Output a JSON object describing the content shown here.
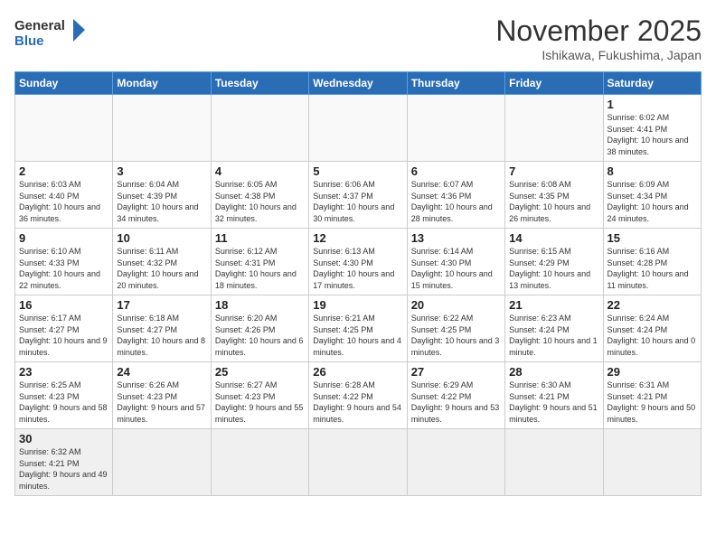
{
  "logo": {
    "line1": "General",
    "line2": "Blue"
  },
  "title": "November 2025",
  "location": "Ishikawa, Fukushima, Japan",
  "days_of_week": [
    "Sunday",
    "Monday",
    "Tuesday",
    "Wednesday",
    "Thursday",
    "Friday",
    "Saturday"
  ],
  "weeks": [
    [
      {
        "day": "",
        "info": ""
      },
      {
        "day": "",
        "info": ""
      },
      {
        "day": "",
        "info": ""
      },
      {
        "day": "",
        "info": ""
      },
      {
        "day": "",
        "info": ""
      },
      {
        "day": "",
        "info": ""
      },
      {
        "day": "1",
        "info": "Sunrise: 6:02 AM\nSunset: 4:41 PM\nDaylight: 10 hours and 38 minutes."
      }
    ],
    [
      {
        "day": "2",
        "info": "Sunrise: 6:03 AM\nSunset: 4:40 PM\nDaylight: 10 hours and 36 minutes."
      },
      {
        "day": "3",
        "info": "Sunrise: 6:04 AM\nSunset: 4:39 PM\nDaylight: 10 hours and 34 minutes."
      },
      {
        "day": "4",
        "info": "Sunrise: 6:05 AM\nSunset: 4:38 PM\nDaylight: 10 hours and 32 minutes."
      },
      {
        "day": "5",
        "info": "Sunrise: 6:06 AM\nSunset: 4:37 PM\nDaylight: 10 hours and 30 minutes."
      },
      {
        "day": "6",
        "info": "Sunrise: 6:07 AM\nSunset: 4:36 PM\nDaylight: 10 hours and 28 minutes."
      },
      {
        "day": "7",
        "info": "Sunrise: 6:08 AM\nSunset: 4:35 PM\nDaylight: 10 hours and 26 minutes."
      },
      {
        "day": "8",
        "info": "Sunrise: 6:09 AM\nSunset: 4:34 PM\nDaylight: 10 hours and 24 minutes."
      }
    ],
    [
      {
        "day": "9",
        "info": "Sunrise: 6:10 AM\nSunset: 4:33 PM\nDaylight: 10 hours and 22 minutes."
      },
      {
        "day": "10",
        "info": "Sunrise: 6:11 AM\nSunset: 4:32 PM\nDaylight: 10 hours and 20 minutes."
      },
      {
        "day": "11",
        "info": "Sunrise: 6:12 AM\nSunset: 4:31 PM\nDaylight: 10 hours and 18 minutes."
      },
      {
        "day": "12",
        "info": "Sunrise: 6:13 AM\nSunset: 4:30 PM\nDaylight: 10 hours and 17 minutes."
      },
      {
        "day": "13",
        "info": "Sunrise: 6:14 AM\nSunset: 4:30 PM\nDaylight: 10 hours and 15 minutes."
      },
      {
        "day": "14",
        "info": "Sunrise: 6:15 AM\nSunset: 4:29 PM\nDaylight: 10 hours and 13 minutes."
      },
      {
        "day": "15",
        "info": "Sunrise: 6:16 AM\nSunset: 4:28 PM\nDaylight: 10 hours and 11 minutes."
      }
    ],
    [
      {
        "day": "16",
        "info": "Sunrise: 6:17 AM\nSunset: 4:27 PM\nDaylight: 10 hours and 9 minutes."
      },
      {
        "day": "17",
        "info": "Sunrise: 6:18 AM\nSunset: 4:27 PM\nDaylight: 10 hours and 8 minutes."
      },
      {
        "day": "18",
        "info": "Sunrise: 6:20 AM\nSunset: 4:26 PM\nDaylight: 10 hours and 6 minutes."
      },
      {
        "day": "19",
        "info": "Sunrise: 6:21 AM\nSunset: 4:25 PM\nDaylight: 10 hours and 4 minutes."
      },
      {
        "day": "20",
        "info": "Sunrise: 6:22 AM\nSunset: 4:25 PM\nDaylight: 10 hours and 3 minutes."
      },
      {
        "day": "21",
        "info": "Sunrise: 6:23 AM\nSunset: 4:24 PM\nDaylight: 10 hours and 1 minute."
      },
      {
        "day": "22",
        "info": "Sunrise: 6:24 AM\nSunset: 4:24 PM\nDaylight: 10 hours and 0 minutes."
      }
    ],
    [
      {
        "day": "23",
        "info": "Sunrise: 6:25 AM\nSunset: 4:23 PM\nDaylight: 9 hours and 58 minutes."
      },
      {
        "day": "24",
        "info": "Sunrise: 6:26 AM\nSunset: 4:23 PM\nDaylight: 9 hours and 57 minutes."
      },
      {
        "day": "25",
        "info": "Sunrise: 6:27 AM\nSunset: 4:23 PM\nDaylight: 9 hours and 55 minutes."
      },
      {
        "day": "26",
        "info": "Sunrise: 6:28 AM\nSunset: 4:22 PM\nDaylight: 9 hours and 54 minutes."
      },
      {
        "day": "27",
        "info": "Sunrise: 6:29 AM\nSunset: 4:22 PM\nDaylight: 9 hours and 53 minutes."
      },
      {
        "day": "28",
        "info": "Sunrise: 6:30 AM\nSunset: 4:21 PM\nDaylight: 9 hours and 51 minutes."
      },
      {
        "day": "29",
        "info": "Sunrise: 6:31 AM\nSunset: 4:21 PM\nDaylight: 9 hours and 50 minutes."
      }
    ],
    [
      {
        "day": "30",
        "info": "Sunrise: 6:32 AM\nSunset: 4:21 PM\nDaylight: 9 hours and 49 minutes."
      },
      {
        "day": "",
        "info": ""
      },
      {
        "day": "",
        "info": ""
      },
      {
        "day": "",
        "info": ""
      },
      {
        "day": "",
        "info": ""
      },
      {
        "day": "",
        "info": ""
      },
      {
        "day": "",
        "info": ""
      }
    ]
  ]
}
